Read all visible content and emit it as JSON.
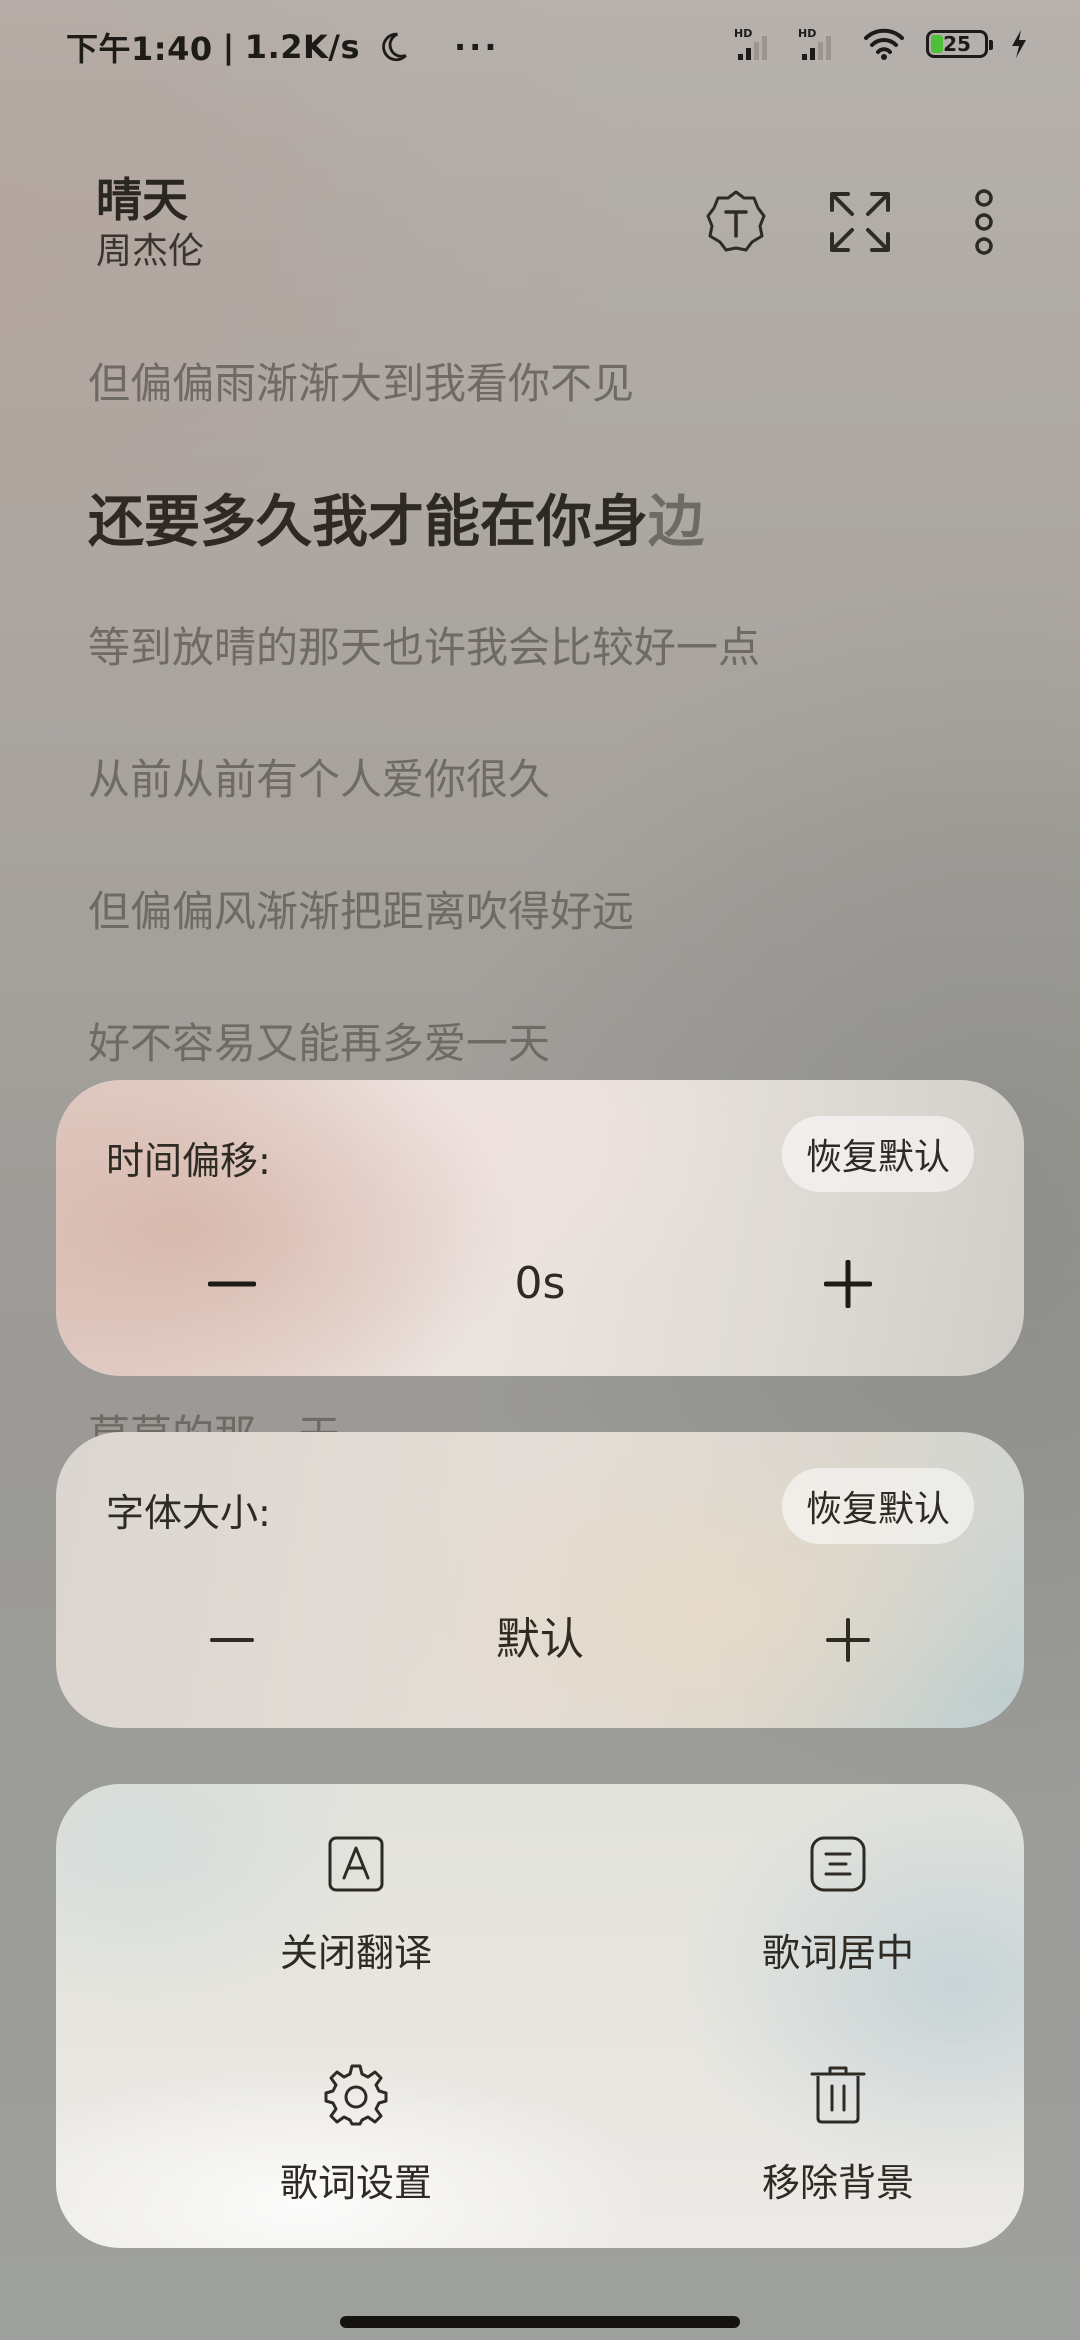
{
  "status_bar": {
    "time": "下午1:40",
    "separator": "|",
    "net_speed": "1.2K/s",
    "more": "···",
    "sim1": "HD",
    "sim2": "HD",
    "battery": "25"
  },
  "song": {
    "title": "晴天",
    "artist": "周杰伦"
  },
  "header_icons": [
    "translate-icon",
    "fullscreen-icon",
    "more-icon"
  ],
  "lyrics": {
    "line1": "但偏偏雨渐渐大到我看你不见",
    "active_highlight": "还要多久我才能在你身",
    "active_tail": "边",
    "line3": "等到放晴的那天也许我会比较好一点",
    "line4": "从前从前有个人爱你很久",
    "line5": "但偏偏风渐渐把距离吹得好远",
    "line6": "好不容易又能再多爱一天",
    "peek": "莫莫的那一天"
  },
  "time_offset": {
    "label": "时间偏移:",
    "reset": "恢复默认",
    "value": "0s"
  },
  "font_size": {
    "label": "字体大小:",
    "reset": "恢复默认",
    "value": "默认"
  },
  "actions": [
    {
      "label": "关闭翻译",
      "icon": "translate-off-icon"
    },
    {
      "label": "歌词居中",
      "icon": "align-center-icon"
    },
    {
      "label": "歌词设置",
      "icon": "gear-icon"
    },
    {
      "label": "移除背景",
      "icon": "trash-icon"
    }
  ],
  "colors": {
    "text_primary": "#2e2a24",
    "text_dim": "#6f6a64",
    "battery_fill": "#4fbf3a"
  }
}
